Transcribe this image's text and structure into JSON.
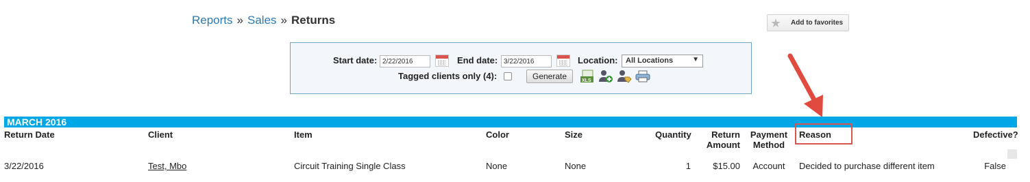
{
  "breadcrumb": {
    "items": [
      "Reports",
      "Sales"
    ],
    "separator": "»",
    "current": "Returns"
  },
  "favorites_button": {
    "label": "Add to favorites",
    "icon": "star-icon"
  },
  "filters": {
    "start_date_label": "Start date:",
    "start_date_value": "2/22/2016",
    "end_date_label": "End date:",
    "end_date_value": "3/22/2016",
    "location_label": "Location:",
    "location_value": "All Locations",
    "tagged_label": "Tagged clients only (4):",
    "tagged_checked": false,
    "generate_label": "Generate",
    "tool_icons": [
      "xls-export-icon",
      "add-client-icon",
      "tag-clients-icon",
      "print-icon"
    ]
  },
  "report": {
    "month_header": "MARCH 2016",
    "columns": {
      "return_date": "Return Date",
      "client": "Client",
      "item": "Item",
      "color": "Color",
      "size": "Size",
      "quantity": "Quantity",
      "return_amount_1": "Return",
      "return_amount_2": "Amount",
      "payment_method_1": "Payment",
      "payment_method_2": "Method",
      "reason": "Reason",
      "defective": "Defective?"
    },
    "rows": [
      {
        "return_date": "3/22/2016",
        "client": "Test, Mbo",
        "item": "Circuit Training Single Class",
        "color": "None",
        "size": "None",
        "quantity": "1",
        "return_amount": "$15.00",
        "payment_method": "Account",
        "reason": "Decided to purchase different item",
        "defective": "False"
      }
    ]
  },
  "colors": {
    "accent_bar": "#00a7e6",
    "link": "#2a7ab8",
    "annotation": "#d9534f"
  }
}
